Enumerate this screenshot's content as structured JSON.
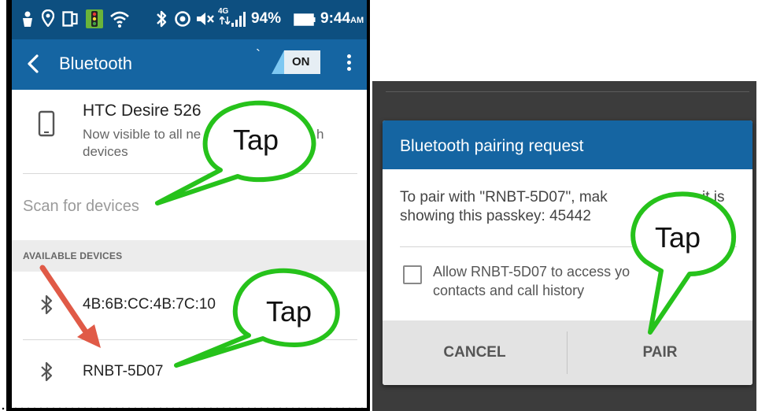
{
  "status_bar": {
    "battery_percent": "94%",
    "time": "9:44",
    "ampm": "AM",
    "network": "4G",
    "icons": [
      "notification-icon",
      "location-icon",
      "cast-icon",
      "app-icon",
      "wifi-icon",
      "bluetooth-icon",
      "sync-icon",
      "mute-icon",
      "signal-icon",
      "battery-icon"
    ]
  },
  "action_bar": {
    "title": "Bluetooth",
    "tick": "`",
    "toggle_label": "ON"
  },
  "device": {
    "name": "HTC Desire 526",
    "visibility_line1": "Now visible to all ne",
    "visibility_line1_end": "h",
    "visibility_line2": "devices"
  },
  "scan_label": "Scan for devices",
  "available_header": "AVAILABLE DEVICES",
  "available_devices": [
    {
      "name": "4B:6B:CC:4B:7C:10"
    },
    {
      "name": "RNBT-5D07"
    }
  ],
  "dialog": {
    "title": "Bluetooth pairing request",
    "message_line1_a": "To pair with \"RNBT-5D07\", mak",
    "message_line1_b": "it is",
    "message_line2": "showing this passkey: 45442",
    "checkbox_line1": "Allow RNBT-5D07 to access yo",
    "checkbox_line2": "contacts and call history",
    "checkbox_checked": false,
    "cancel_label": "CANCEL",
    "pair_label": "PAIR"
  },
  "annotations": {
    "tap_1": "Tap",
    "tap_2": "Tap",
    "tap_3": "Tap"
  },
  "colors": {
    "status_bar": "#0d4f80",
    "action_bar": "#1565a2",
    "bubble_fill": "#ffffff",
    "bubble_stroke": "#26c21b",
    "arrow": "#e05a47"
  }
}
